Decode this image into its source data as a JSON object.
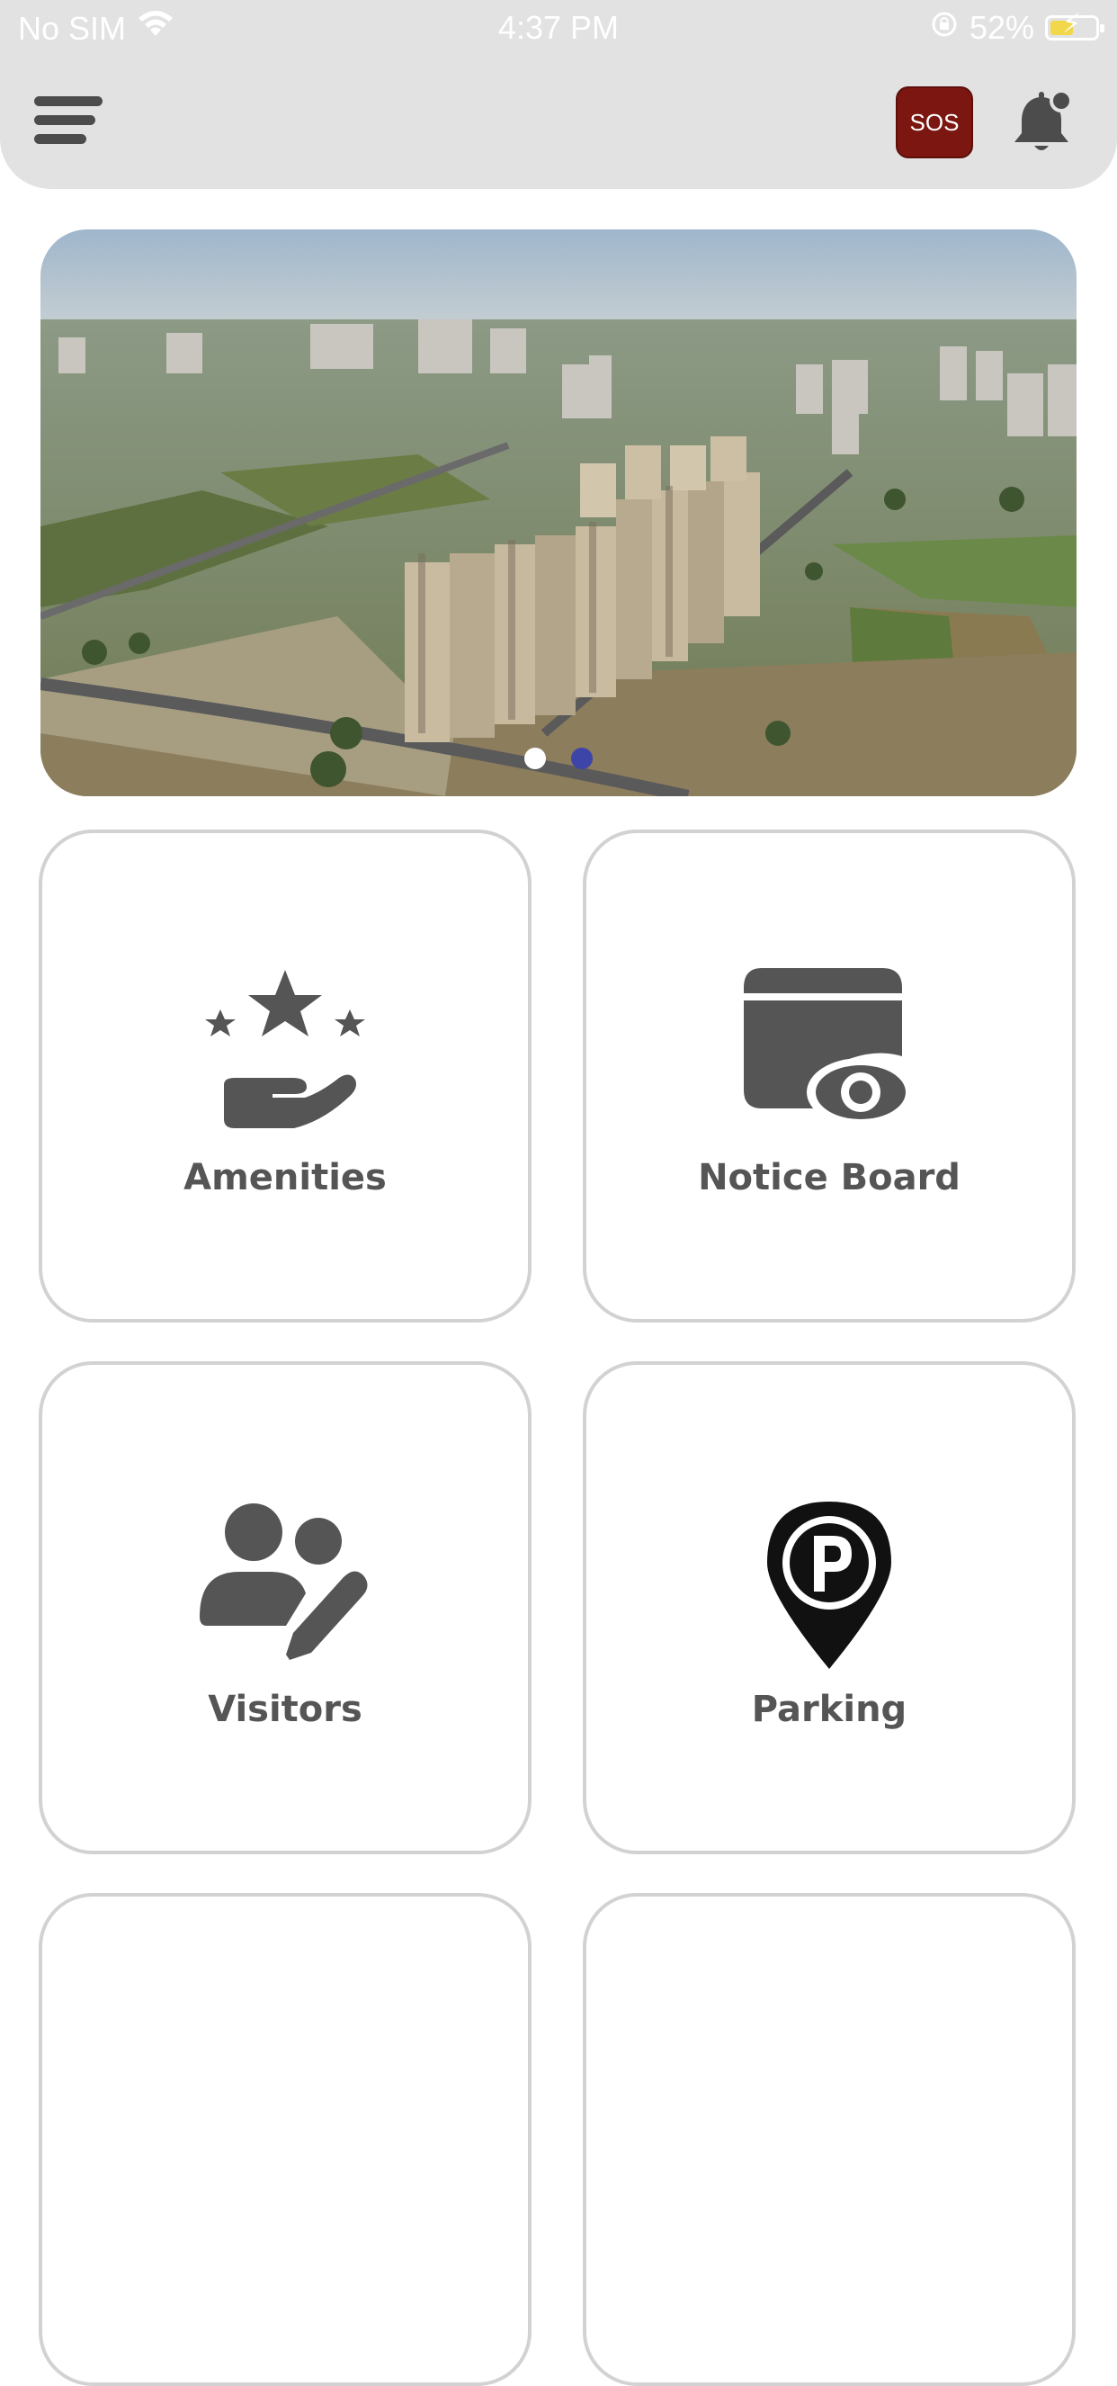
{
  "status_bar": {
    "carrier": "No SIM",
    "time": "4:37 PM",
    "battery": "52%",
    "battery_level": 0.52
  },
  "header": {
    "sos_label": "SOS",
    "menu_icon": "hamburger-menu-icon",
    "bell_icon": "notification-bell-icon"
  },
  "banner": {
    "slide_count": 2,
    "active_slide": 2
  },
  "tiles": [
    {
      "label": "Amenities",
      "icon": "amenities-icon"
    },
    {
      "label": "Notice Board",
      "icon": "notice-board-icon"
    },
    {
      "label": "Visitors",
      "icon": "visitors-icon"
    },
    {
      "label": "Parking",
      "icon": "parking-icon"
    }
  ],
  "colors": {
    "header_bg": "#e2e2e2",
    "sos_bg": "#7b1710",
    "icon_gray": "#555555",
    "dot_active": "#3d45a8",
    "tile_border": "#d2d2d2"
  }
}
